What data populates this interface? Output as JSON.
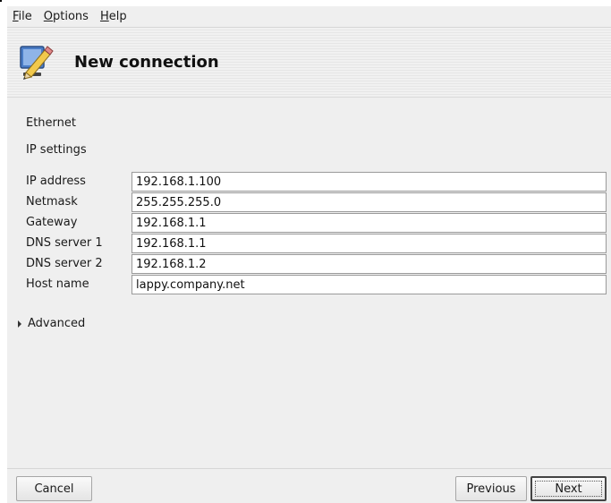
{
  "menu": {
    "file": {
      "accel": "F",
      "rest": "ile"
    },
    "options": {
      "accel": "O",
      "rest": "ptions"
    },
    "help": {
      "accel": "H",
      "rest": "elp"
    }
  },
  "header": {
    "title": "New connection",
    "icon": "pencil-monitor-icon"
  },
  "content": {
    "connection_type": "Ethernet",
    "section": "IP settings",
    "fields": [
      {
        "label": "IP address",
        "value": "192.168.1.100"
      },
      {
        "label": "Netmask",
        "value": "255.255.255.0"
      },
      {
        "label": "Gateway",
        "value": "192.168.1.1"
      },
      {
        "label": "DNS server 1",
        "value": "192.168.1.1"
      },
      {
        "label": "DNS server 2",
        "value": "192.168.1.2"
      },
      {
        "label": "Host name",
        "value": "lappy.company.net"
      }
    ],
    "advanced": "Advanced"
  },
  "buttons": {
    "cancel": "Cancel",
    "previous": "Previous",
    "next": "Next"
  },
  "colors": {
    "window_bg": "#efefef",
    "input_border": "#9a9a9a",
    "default_button_border": "#444444"
  }
}
